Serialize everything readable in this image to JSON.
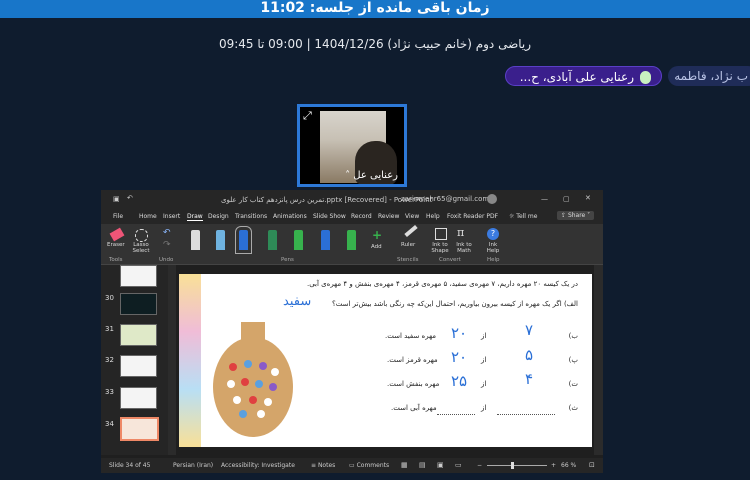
{
  "header": {
    "timer_text": "زمان باقی مانده از جلسه: 11:02"
  },
  "session": {
    "title": "ریاضی دوم (خانم حبیب نژاد) 1404/12/26 | 09:00 تا 09:45"
  },
  "participants": [
    {
      "name": "رعنایی علی آبادی، ح...",
      "speaking": true
    },
    {
      "name": "ب نژاد، فاطمه",
      "speaking": false
    }
  ],
  "video": {
    "label": "رعنایی عل"
  },
  "ppt": {
    "file_title": "تمرین درس پانزدهم کتاب کار علوی.pptx [Recovered] - PowerPoint",
    "account": "zarinmehr65@gmail.com",
    "tabs": [
      "File",
      "Home",
      "Insert",
      "Draw",
      "Design",
      "Transitions",
      "Animations",
      "Slide Show",
      "Record",
      "Review",
      "View",
      "Help",
      "Foxit Reader PDF"
    ],
    "tell_me": "Tell me",
    "share": "Share",
    "tools": {
      "eraser": "Eraser",
      "lasso": "Lasso Select",
      "add": "Add",
      "ruler": "Ruler",
      "ink_shape": "Ink to Shape",
      "ink_math": "Ink to Math",
      "ink_help": "Ink Help"
    },
    "groups": {
      "tools": "Tools",
      "undo": "Undo",
      "pens": "Pens",
      "stencils": "Stencils",
      "convert": "Convert",
      "help": "Help"
    },
    "pen_colors": [
      "#dddddd",
      "#6fb3e0",
      "#2b6fd6",
      "#2e8b57",
      "#37b24d",
      "#2b6fd6",
      "#37b24d"
    ],
    "thumb_numbers": [
      "30",
      "31",
      "32",
      "33",
      "34"
    ],
    "status": {
      "slide": "Slide 34 of 45",
      "language": "Persian (Iran)",
      "accessibility": "Accessibility: Investigate",
      "notes": "Notes",
      "comments": "Comments",
      "zoom": "66 %"
    },
    "slide": {
      "q_intro": "در یک کیسه ۲۰ مهره داریم، ۷ مهره‌ی سفید، ۵ مهره‌ی قرمز، ۴ مهره‌ی بنفش و ۴ مهره‌ی آبی.",
      "q_a": "الف) اگر یک مهره از کیسه بیرون بیاوریم، احتمال این‌که چه رنگی باشد بیش‌تر است؟",
      "answer_a": "سفید",
      "rows": [
        {
          "prefix": "ب)",
          "num": "۷",
          "den": "۲۰",
          "text": "مهره سفید است."
        },
        {
          "prefix": "پ)",
          "num": "۵",
          "den": "۲۰",
          "text": "مهره قرمز است."
        },
        {
          "prefix": "ت)",
          "num": "۴",
          "den": "۲۵",
          "text": "مهره بنفش است."
        },
        {
          "prefix": "ث)",
          "num": "",
          "den": "",
          "text": "مهره آبی است."
        }
      ],
      "from_word": "از"
    }
  }
}
